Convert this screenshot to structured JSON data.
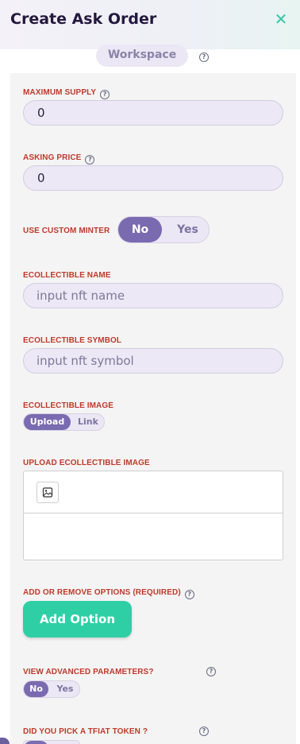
{
  "header": {
    "title": "Create Ask Order",
    "close_icon": "close-icon"
  },
  "workspace": {
    "label": "Workspace"
  },
  "fields": {
    "maximum_supply": {
      "label": "MAXIMUM SUPPLY",
      "value": "0"
    },
    "asking_price": {
      "label": "ASKING PRICE",
      "value": "0"
    },
    "use_custom_minter": {
      "label": "USE CUSTOM MINTER",
      "options": [
        "No",
        "Yes"
      ],
      "selected": "No"
    },
    "ecollectible_name": {
      "label": "ECOLLECTIBLE NAME",
      "placeholder": "input nft name"
    },
    "ecollectible_symbol": {
      "label": "ECOLLECTIBLE SYMBOL",
      "placeholder": "input nft symbol"
    },
    "ecollectible_image": {
      "label": "ECOLLECTIBLE IMAGE",
      "options": [
        "Upload",
        "Link"
      ],
      "selected": "Upload"
    },
    "upload_image": {
      "label": "UPLOAD ECOLLECTIBLE IMAGE",
      "icon": "image-icon"
    },
    "options": {
      "label": "ADD OR REMOVE OPTIONS (REQUIRED)",
      "button": "Add Option"
    },
    "advanced": {
      "label": "VIEW ADVANCED PARAMETERS?",
      "options": [
        "No",
        "Yes"
      ],
      "selected": "No"
    },
    "tfiat": {
      "label": "DID YOU PICK A TFIAT TOKEN ?"
    }
  },
  "colors": {
    "accent": "#2fcfa6",
    "toggle_active": "#7a6ab0",
    "label_red": "#c0392b",
    "title": "#23183f"
  }
}
